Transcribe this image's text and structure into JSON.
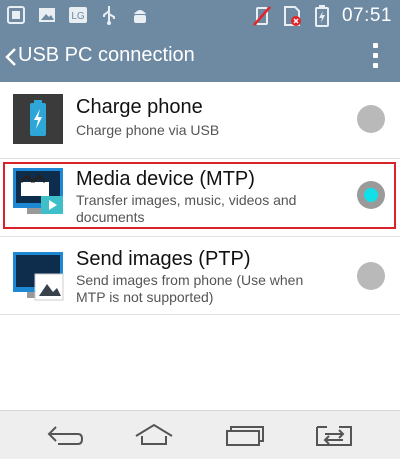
{
  "status_bar": {
    "time": "07:51",
    "left_icons": [
      "usb-icon-square",
      "image-icon",
      "lg-icon",
      "usb-icon",
      "android-debug-icon"
    ],
    "lg_label": "LG"
  },
  "header": {
    "title": "USB PC connection"
  },
  "options": [
    {
      "title": "Charge phone",
      "subtitle": "Charge phone via USB",
      "selected": false
    },
    {
      "title": "Media device (MTP)",
      "subtitle": "Transfer images, music, videos and documents",
      "selected": true
    },
    {
      "title": "Send images (PTP)",
      "subtitle": "Send images from phone (Use when MTP is not supported)",
      "selected": false
    }
  ],
  "colors": {
    "bar": "#6e8aa3",
    "radio_selected": "#10e0e8",
    "highlight": "#d8232a"
  }
}
